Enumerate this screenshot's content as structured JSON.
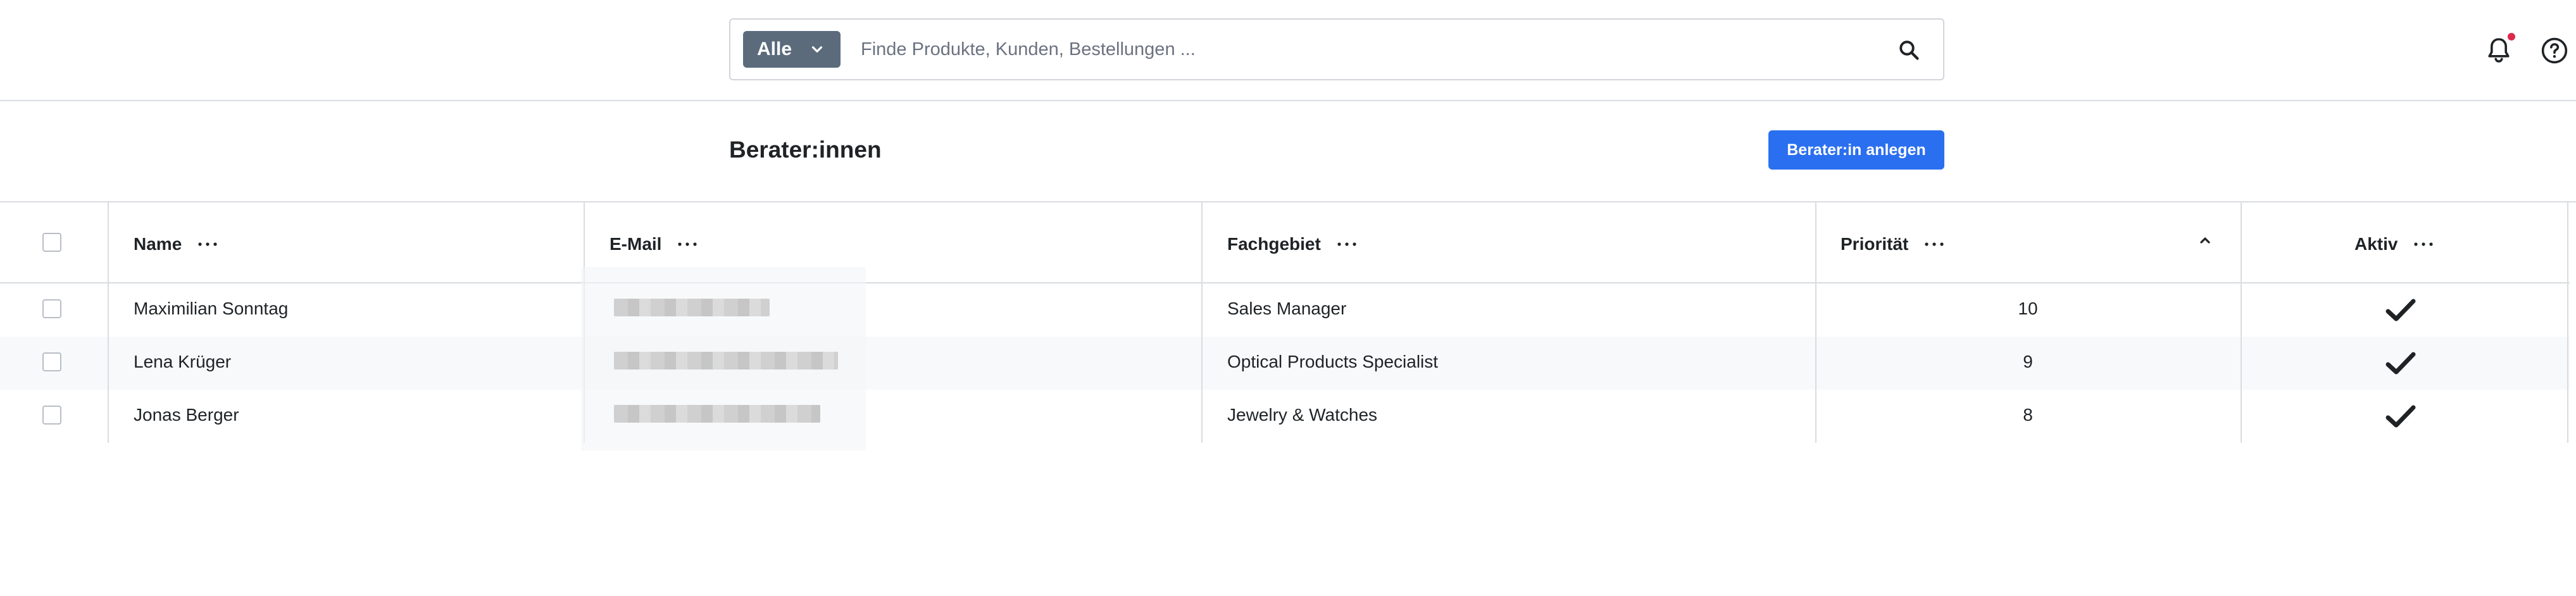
{
  "search": {
    "scope_label": "Alle",
    "placeholder": "Finde Produkte, Kunden, Bestellungen ...",
    "value": ""
  },
  "header": {
    "title": "Berater:innen",
    "create_button": "Berater:in anlegen"
  },
  "table": {
    "columns": {
      "name": "Name",
      "email": "E-Mail",
      "field": "Fachgebiet",
      "priority": "Priorität",
      "active": "Aktiv"
    },
    "sort": {
      "column": "priority",
      "direction": "ascending"
    },
    "rows": [
      {
        "name": "Maximilian Sonntag",
        "email": "[redacted]",
        "field": "Sales Manager",
        "priority": "10",
        "active": true
      },
      {
        "name": "Lena Krüger",
        "email": "[redacted]",
        "field": "Optical Products Specialist",
        "priority": "9",
        "active": true
      },
      {
        "name": "Jonas Berger",
        "email": "[redacted]",
        "field": "Jewelry & Watches",
        "priority": "8",
        "active": true
      }
    ]
  },
  "icons": {
    "scope_chevron": "chevron-down-icon",
    "search": "search-icon",
    "notifications": "bell-icon",
    "help": "help-icon",
    "column_menu": "ellipsis-icon",
    "sort": "chevron-up-icon",
    "active": "checkmark-icon"
  },
  "colors": {
    "primary": "#2a6ff0",
    "scope_button": "#5b6b7c",
    "notification_dot": "#de294c",
    "border": "#d9dce0",
    "row_alt": "#f8f9fb"
  }
}
